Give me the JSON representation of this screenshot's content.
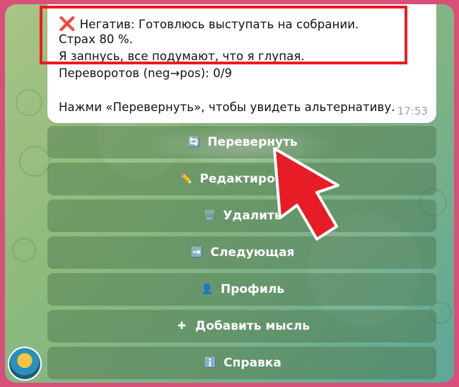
{
  "message": {
    "line1_mark": "❌",
    "line1_text": "Негатив: Готовлюсь выступать на собрании.",
    "line2": "Страх 80 %.",
    "line3": "Я запнусь, все подумают, что я глупая.",
    "line4": "Переворотов (neg→pos): 0/9",
    "line5": "Нажми «Перевернуть», чтобы увидеть альтернативу.",
    "time": "17:53"
  },
  "keyboard": {
    "buttons": [
      {
        "icon": "🔄",
        "icon_name": "refresh-icon",
        "label": "Перевернуть"
      },
      {
        "icon": "✏️",
        "icon_name": "pencil-icon",
        "label": "Редактировать"
      },
      {
        "icon": "🗑️",
        "icon_name": "trash-icon",
        "label": "Удалить"
      },
      {
        "icon": "➡️",
        "icon_name": "arrow-right-icon",
        "label": "Следующая"
      },
      {
        "icon": "👤",
        "icon_name": "user-icon",
        "label": "Профиль"
      },
      {
        "icon": "✚",
        "icon_name": "plus-icon",
        "label": "Добавить мысль"
      },
      {
        "icon": "ℹ️",
        "icon_name": "info-icon",
        "label": "Справка"
      }
    ]
  },
  "colors": {
    "frame": "#d8507a",
    "highlight_border": "#e81c24",
    "arrow": "#e81c24",
    "button_bg": "rgba(70,110,70,0.42)",
    "time_text": "#9aa3ab"
  }
}
